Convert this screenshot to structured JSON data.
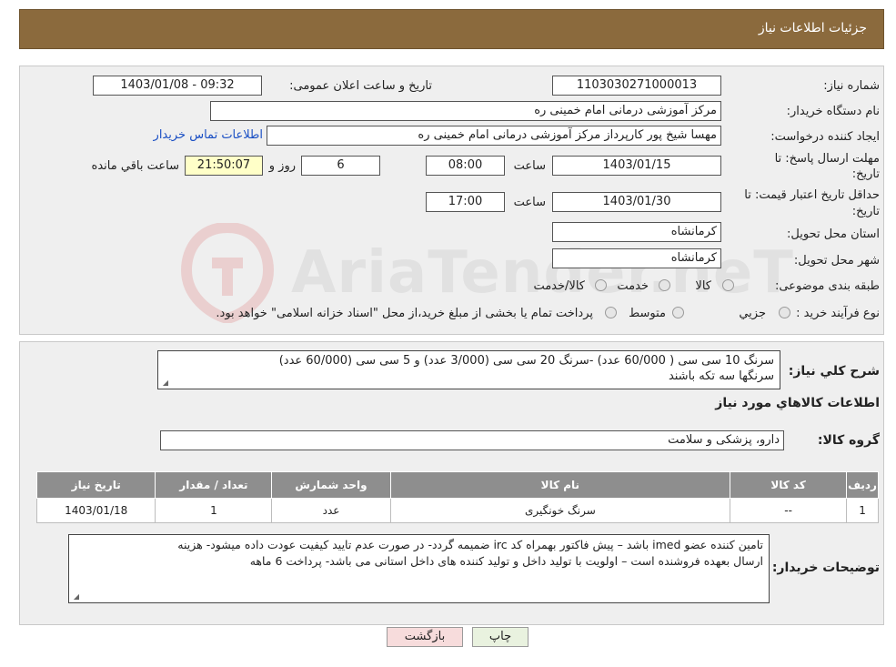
{
  "header": {
    "title": "جزئیات اطلاعات نیاز"
  },
  "form": {
    "need_number": {
      "label": "شماره نیاز:",
      "value": "1103030271000013"
    },
    "announce_datetime": {
      "label": "تاریخ و ساعت اعلان عمومی:",
      "value": "1403/01/08 - 09:32"
    },
    "buyer_org": {
      "label": "نام دستگاه خریدار:",
      "value": "مرکز آموزشی درمانی امام خمینی ره"
    },
    "requester": {
      "label": "ایجاد کننده درخواست:",
      "value": "مهسا شیخ پور کارپرداز مرکز آموزشی درمانی امام خمینی ره",
      "contact_link": "اطلاعات تماس خریدار"
    },
    "reply_deadline": {
      "label_line1": "مهلت ارسال پاسخ: تا",
      "label_line2": "تاریخ:",
      "date": "1403/01/15",
      "time_label": "ساعت",
      "time": "08:00",
      "days": "6",
      "days_label": "روز و",
      "remaining": "21:50:07",
      "remaining_label": "ساعت باقي مانده"
    },
    "price_validity": {
      "label_line1": "حداقل تاریخ اعتبار قیمت: تا",
      "label_line2": "تاریخ:",
      "date": "1403/01/30",
      "time_label": "ساعت",
      "time": "17:00"
    },
    "delivery_province": {
      "label": "استان محل تحویل:",
      "value": "کرمانشاه"
    },
    "delivery_city": {
      "label": "شهر محل تحویل:",
      "value": "کرمانشاه"
    },
    "category": {
      "label": "طبقه بندی موضوعی:",
      "options": [
        "کالا",
        "خدمت",
        "کالا/خدمت"
      ]
    },
    "purchase_process": {
      "label": "نوع فرآیند خرید :",
      "options": [
        "جزیي",
        "متوسط"
      ],
      "note": "پرداخت تمام یا بخشی از مبلغ خرید،از محل \"اسناد خزانه اسلامی\" خواهد بود."
    }
  },
  "description": {
    "label": "شرح کلي نياز:",
    "text_line1": "سرنگ 10 سی سی ( 60/000 عدد) -سرنگ 20 سی سی (3/000 عدد) و 5 سی سی (60/000 عدد)",
    "text_line2": "سرنگها سه تکه باشند"
  },
  "goods_section": {
    "title": "اطلاعات کالاهاي مورد نياز",
    "group_label": "گروه کالا:",
    "group_value": "دارو، پزشکی و سلامت"
  },
  "table": {
    "headers": [
      "رديف",
      "کد کالا",
      "نام کالا",
      "واحد شمارش",
      "تعداد / مقدار",
      "تاریخ نیاز"
    ],
    "rows": [
      [
        "1",
        "--",
        "سرنگ خونگیری",
        "عدد",
        "1",
        "1403/01/18"
      ]
    ]
  },
  "buyer_notes": {
    "label": "توضیحات خریدار:",
    "text_line1": "تامین کننده عضو imed باشد – پیش فاکتور بهمراه کد irc ضمیمه گردد- در صورت عدم تایید کیفیت عودت داده میشود- هزینه",
    "text_line2": "ارسال بعهده فروشنده است – اولویت با تولید داخل و تولید کننده های داخل استانی می باشد- پرداخت 6 ماهه"
  },
  "buttons": {
    "print": "چاپ",
    "back": "بازگشت"
  },
  "watermark": {
    "text": "AriaTender.neT"
  },
  "colors": {
    "header_bg": "#8b6a3d",
    "table_header_bg": "#8e8e8e",
    "remaining_bg": "#ffffc8",
    "link": "#1a4fc4"
  }
}
